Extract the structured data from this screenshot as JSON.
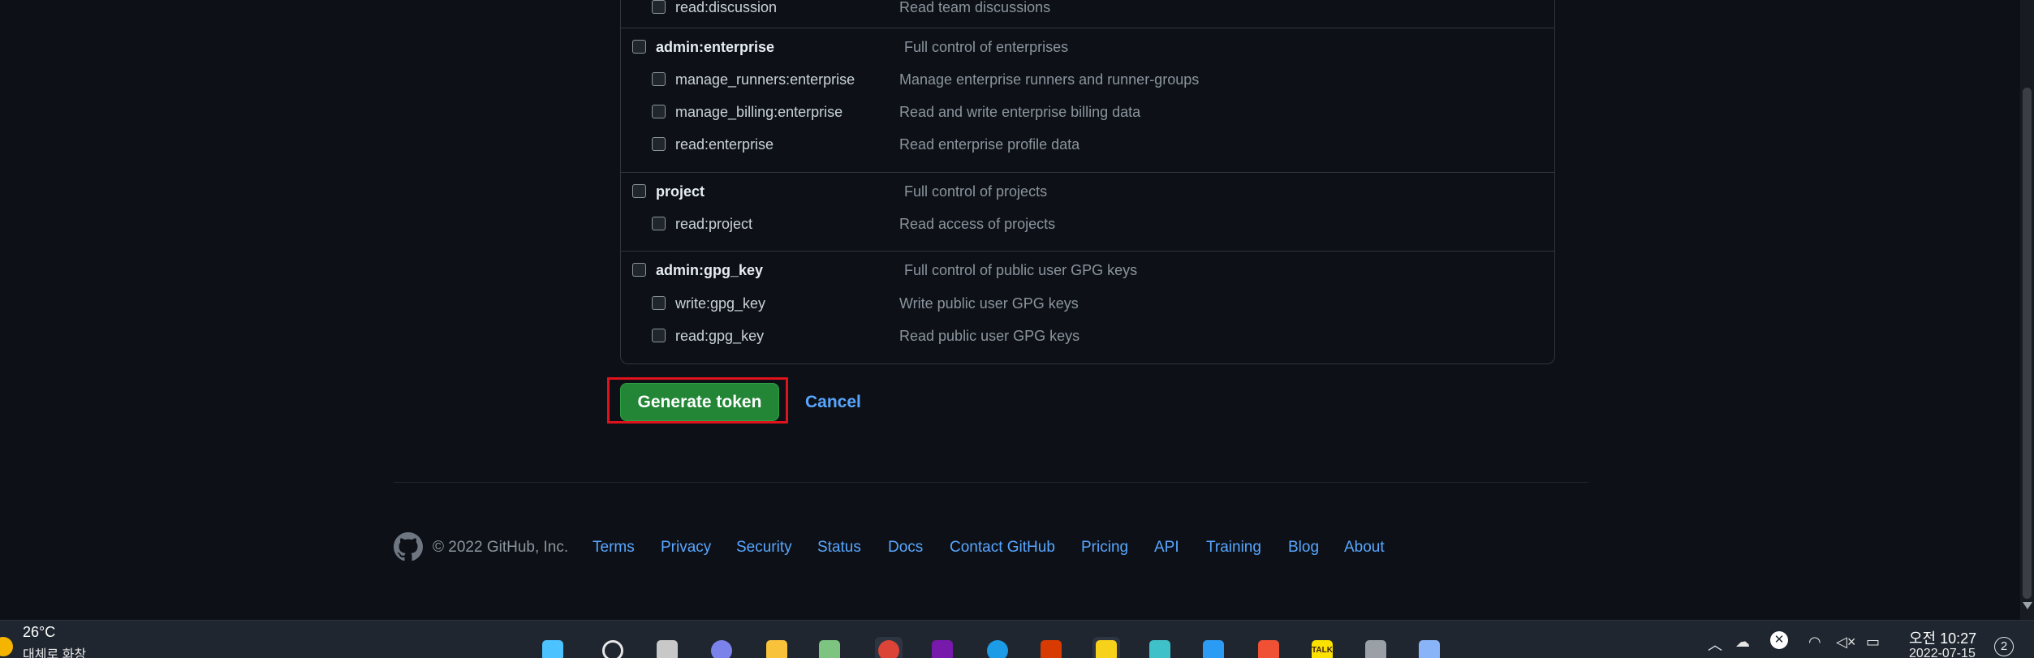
{
  "scopes": [
    {
      "name": "read:discussion",
      "desc": "Read team discussions",
      "level": "child"
    },
    {
      "name": "admin:enterprise",
      "desc": "Full control of enterprises",
      "level": "parent"
    },
    {
      "name": "manage_runners:enterprise",
      "desc": "Manage enterprise runners and runner-groups",
      "level": "child"
    },
    {
      "name": "manage_billing:enterprise",
      "desc": "Read and write enterprise billing data",
      "level": "child"
    },
    {
      "name": "read:enterprise",
      "desc": "Read enterprise profile data",
      "level": "child"
    },
    {
      "name": "project",
      "desc": "Full control of projects",
      "level": "parent"
    },
    {
      "name": "read:project",
      "desc": "Read access of projects",
      "level": "child"
    },
    {
      "name": "admin:gpg_key",
      "desc": "Full control of public user GPG keys",
      "level": "parent"
    },
    {
      "name": "write:gpg_key",
      "desc": "Write public user GPG keys",
      "level": "child"
    },
    {
      "name": "read:gpg_key",
      "desc": "Read public user GPG keys",
      "level": "child"
    }
  ],
  "actions": {
    "generate_label": "Generate token",
    "cancel_label": "Cancel"
  },
  "footer": {
    "copyright": "© 2022 GitHub, Inc.",
    "links": [
      "Terms",
      "Privacy",
      "Security",
      "Status",
      "Docs",
      "Contact GitHub",
      "Pricing",
      "API",
      "Training",
      "Blog",
      "About"
    ]
  },
  "taskbar": {
    "weather_temp": "26°C",
    "weather_desc": "대체로 화창",
    "apps": [
      "start-icon",
      "search-icon",
      "task-view-icon",
      "teams-chat-icon",
      "file-explorer-icon",
      "notepad-icon",
      "chrome-icon",
      "onenote-icon",
      "edge-icon",
      "office-icon",
      "sticky-notes-icon",
      "app-star-icon",
      "vscode-icon",
      "git-icon",
      "kakaotalk-icon",
      "settings-icon",
      "calculator-icon"
    ],
    "kakaotalk_label": "TALK",
    "clock_time": "오전 10:27",
    "clock_date": "2022-07-15",
    "notification_count": "2"
  },
  "colors": {
    "background": "#0d1117",
    "primary_button": "#238636",
    "link": "#58a6ff",
    "highlight_box": "#e0121b"
  }
}
